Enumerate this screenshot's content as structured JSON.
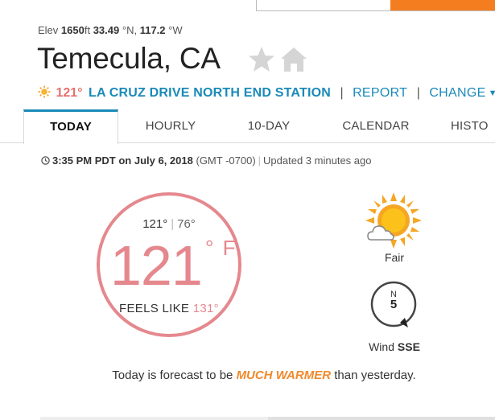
{
  "header": {
    "elev_label": "Elev",
    "elev_value": "1650",
    "elev_unit": "ft",
    "lat_value": "33.49",
    "lat_suffix": "°N,",
    "lon_value": "117.2",
    "lon_suffix": "°W",
    "city": "Temecula, CA",
    "star_icon": "star-icon",
    "home_icon": "home-icon"
  },
  "station": {
    "icon": "sun-icon",
    "temp": "121°",
    "name": "LA CRUZ DRIVE NORTH END STATION",
    "separator": "|",
    "report_label": "REPORT",
    "change_label": "CHANGE"
  },
  "tabs": [
    {
      "label": "TODAY",
      "active": true
    },
    {
      "label": "HOURLY",
      "active": false
    },
    {
      "label": "10-DAY",
      "active": false
    },
    {
      "label": "CALENDAR",
      "active": false
    },
    {
      "label": "HISTO",
      "active": false
    }
  ],
  "observation": {
    "time_date": "3:35 PM PDT on July 6, 2018",
    "timezone": "(GMT -0700)",
    "separator": "|",
    "updated": "Updated 3 minutes ago"
  },
  "current": {
    "high": "121°",
    "separator": "|",
    "low": "76°",
    "temp": "121",
    "unit": "° F",
    "feels_like_label": "FEELS LIKE",
    "feels_like_value": "131°",
    "gauge_color": "#e5888e"
  },
  "condition": {
    "icon": "partly-sunny-icon",
    "label": "Fair"
  },
  "wind": {
    "dial_direction": "N",
    "speed": "5",
    "label": "Wind",
    "direction": "SSE"
  },
  "forecast": {
    "prefix": "Today is forecast to be",
    "highlight": "MUCH WARMER",
    "suffix": "than yesterday."
  },
  "colors": {
    "accent": "#1a8ab8",
    "temp": "#e5888e",
    "orange": "#f0892c"
  }
}
